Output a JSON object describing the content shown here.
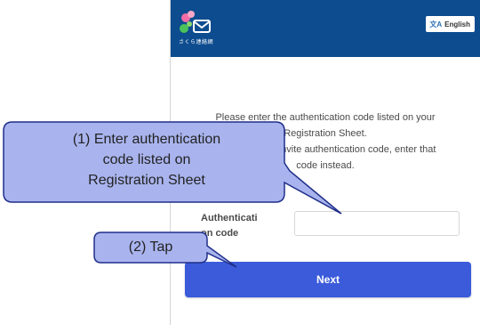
{
  "header": {
    "logo_text": "さくら連絡網",
    "language_label": "English",
    "language_icon": "translate-icon"
  },
  "form": {
    "instruction_lines": [
      "Please enter the authentication code listed on your",
      "Registration Sheet.",
      "If you have an invite authentication code, enter that",
      "code instead."
    ],
    "field_label_line1": "Authenticati",
    "field_label_line2": "on code",
    "input_value": "",
    "next_label": "Next"
  },
  "callouts": {
    "first_lines": [
      "(1) Enter authentication",
      "code listed on",
      "Registration Sheet"
    ],
    "second": "(2) Tap"
  },
  "colors": {
    "header": "#0d4c8f",
    "button": "#3b5bdb",
    "callout_fill": "#a9b4ee",
    "callout_stroke": "#1f2f8a"
  }
}
